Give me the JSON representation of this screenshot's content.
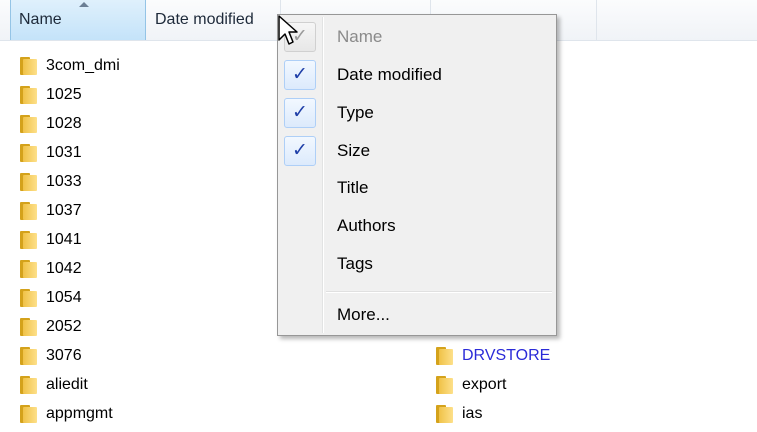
{
  "columns": {
    "name": "Name",
    "date_modified": "Date modified"
  },
  "files_left": [
    {
      "name": "3com_dmi"
    },
    {
      "name": "1025"
    },
    {
      "name": "1028"
    },
    {
      "name": "1031"
    },
    {
      "name": "1033"
    },
    {
      "name": "1037"
    },
    {
      "name": "1041"
    },
    {
      "name": "1042"
    },
    {
      "name": "1054"
    },
    {
      "name": "2052"
    },
    {
      "name": "3076"
    },
    {
      "name": "aliedit"
    },
    {
      "name": "appmgmt"
    }
  ],
  "files_right": [
    {
      "name": "DRVSTORE"
    },
    {
      "name": "export"
    },
    {
      "name": "ias"
    }
  ],
  "menu": {
    "items": [
      {
        "label": "Name",
        "checked": true,
        "disabled": true
      },
      {
        "label": "Date modified",
        "checked": true,
        "disabled": false
      },
      {
        "label": "Type",
        "checked": true,
        "disabled": false
      },
      {
        "label": "Size",
        "checked": true,
        "disabled": false
      },
      {
        "label": "Title",
        "checked": false,
        "disabled": false
      },
      {
        "label": "Authors",
        "checked": false,
        "disabled": false
      },
      {
        "label": "Tags",
        "checked": false,
        "disabled": false
      }
    ],
    "more": "More..."
  },
  "icons": {
    "check": "checkmark-icon",
    "folder": "folder-icon",
    "cursor": "mouse-pointer-icon"
  },
  "colors": {
    "check": "#1f3fa8",
    "folder": "#f0c248",
    "highlight_text": "#2b2bd8"
  }
}
